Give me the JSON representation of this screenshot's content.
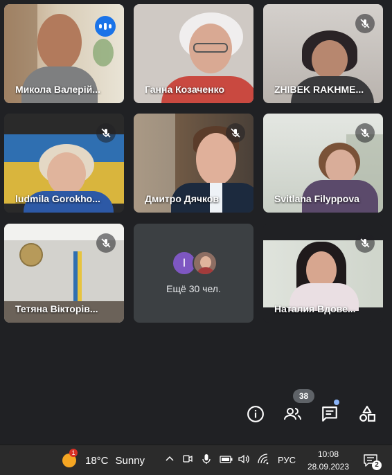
{
  "participants": [
    {
      "name": "Микола Валерій...",
      "state": "speaking"
    },
    {
      "name": "Ганна Козаченко",
      "state": "unmuted"
    },
    {
      "name": "ZHIBEK RAKHME...",
      "state": "muted"
    },
    {
      "name": "ludmila Gorokho...",
      "state": "muted"
    },
    {
      "name": "Дмитро Дячков",
      "state": "muted"
    },
    {
      "name": "Svitlana Filyppova",
      "state": "muted"
    },
    {
      "name": "Тетяна Вікторів...",
      "state": "muted"
    },
    {
      "name": "Наталия Вдове...",
      "state": "muted"
    }
  ],
  "more_tile": {
    "avatar_letter": "I",
    "text": "Ещё 30 чел."
  },
  "controls": {
    "people_count": "38",
    "info_icon": "info-icon",
    "people_icon": "people-icon",
    "chat_icon": "chat-icon",
    "activities_icon": "activities-icon"
  },
  "taskbar": {
    "weather_badge": "1",
    "temperature": "18°C",
    "weather_text": "Sunny",
    "language": "РУС",
    "time": "10:08",
    "date": "28.09.2023",
    "notifications_count": "2"
  },
  "colors": {
    "accent": "#8ab4f8",
    "speaking": "#1a73e8",
    "background": "#202124",
    "tile": "#3c4043"
  }
}
